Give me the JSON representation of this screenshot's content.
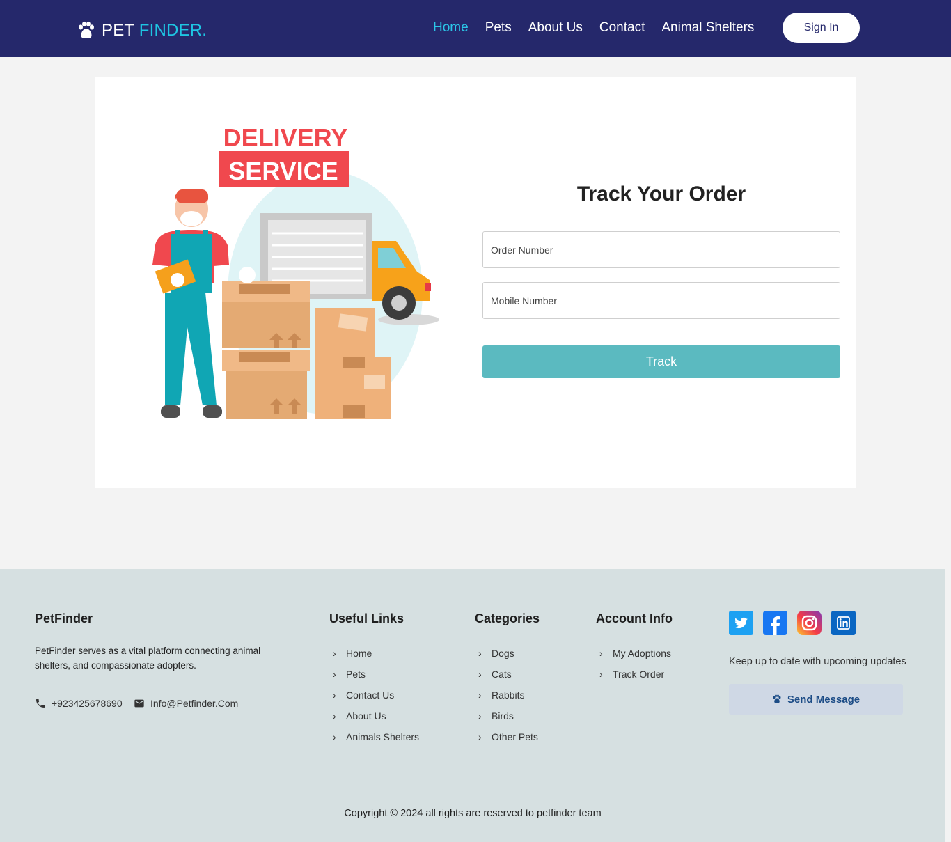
{
  "header": {
    "logo_pet": "PET",
    "logo_finder": "FINDER.",
    "nav": [
      {
        "label": "Home",
        "active": true
      },
      {
        "label": "Pets"
      },
      {
        "label": "About Us"
      },
      {
        "label": "Contact"
      },
      {
        "label": "Animal Shelters"
      }
    ],
    "signin_label": "Sign In"
  },
  "main": {
    "illustration": {
      "line1": "DELIVERY",
      "line2": "SERVICE"
    },
    "title": "Track Your Order",
    "order_placeholder": "Order Number",
    "mobile_placeholder": "Mobile Number",
    "track_label": "Track"
  },
  "footer": {
    "brand_title": "PetFinder",
    "about": "PetFinder serves as a vital platform connecting animal shelters, and compassionate adopters.",
    "phone": "+923425678690",
    "email": "Info@Petfinder.Com",
    "useful_links_title": "Useful Links",
    "useful_links": [
      "Home",
      "Pets",
      "Contact Us",
      "About Us",
      "Animals Shelters"
    ],
    "categories_title": "Categories",
    "categories": [
      "Dogs",
      "Cats",
      "Rabbits",
      "Birds",
      "Other Pets"
    ],
    "account_title": "Account Info",
    "account_links": [
      "My Adoptions",
      "Track Order"
    ],
    "social": [
      "twitter-icon",
      "facebook-icon",
      "instagram-icon",
      "linkedin-icon"
    ],
    "updates_text": "Keep up to date with upcoming updates",
    "send_label": "Send Message",
    "copyright": "Copyright © 2024 all rights are reserved to petfinder team"
  },
  "colors": {
    "navbar": "#25286b",
    "accent": "#1ec5e3",
    "track_button": "#5bbac0",
    "footer_bg": "#d6e0e1"
  }
}
